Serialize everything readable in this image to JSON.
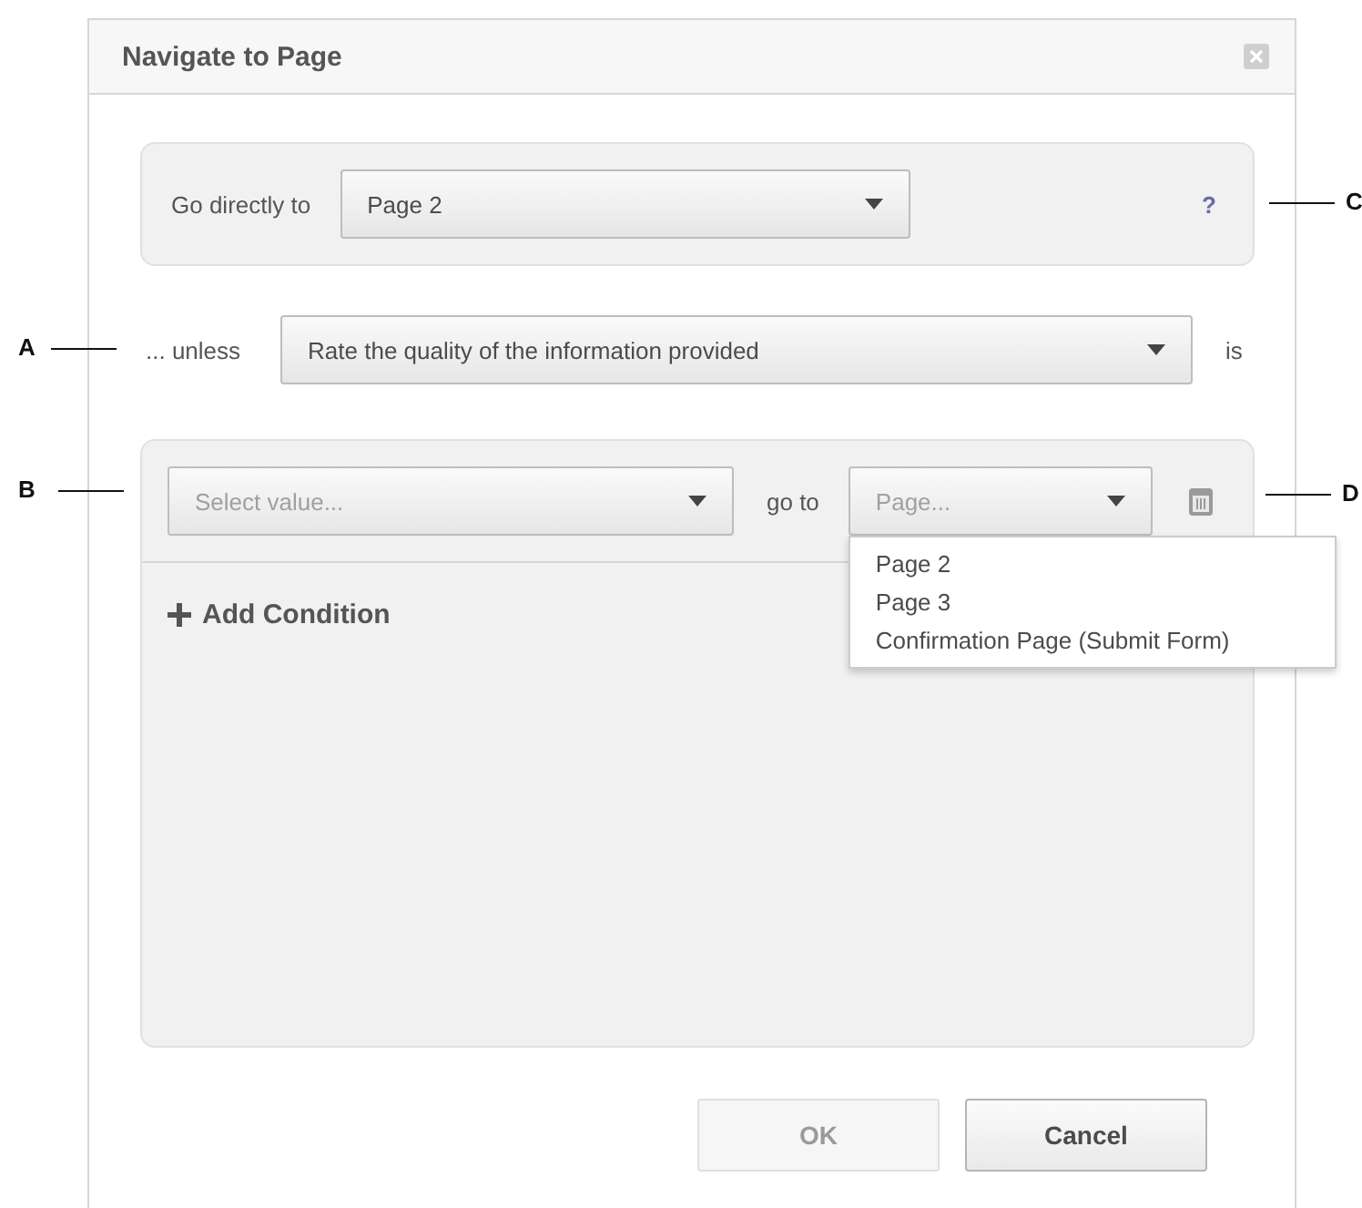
{
  "dialog": {
    "title": "Navigate to Page",
    "go_directly": {
      "label": "Go directly to",
      "value": "Page 2",
      "help": "?"
    },
    "unless": {
      "label": "... unless",
      "value": "Rate the quality of the information provided",
      "suffix": "is"
    },
    "condition": {
      "value_placeholder": "Select value...",
      "goto_label": "go to",
      "page_placeholder": "Page...",
      "menu": [
        {
          "label": "Page 2"
        },
        {
          "label": "Page 3"
        },
        {
          "label": "Confirmation Page (Submit Form)"
        }
      ]
    },
    "add_condition": "Add Condition",
    "buttons": [
      {
        "label": "OK",
        "disabled": true
      },
      {
        "label": "Cancel",
        "disabled": false
      }
    ]
  },
  "callouts": [
    {
      "label": "A"
    },
    {
      "label": "B"
    },
    {
      "label": "C"
    },
    {
      "label": "D"
    }
  ]
}
